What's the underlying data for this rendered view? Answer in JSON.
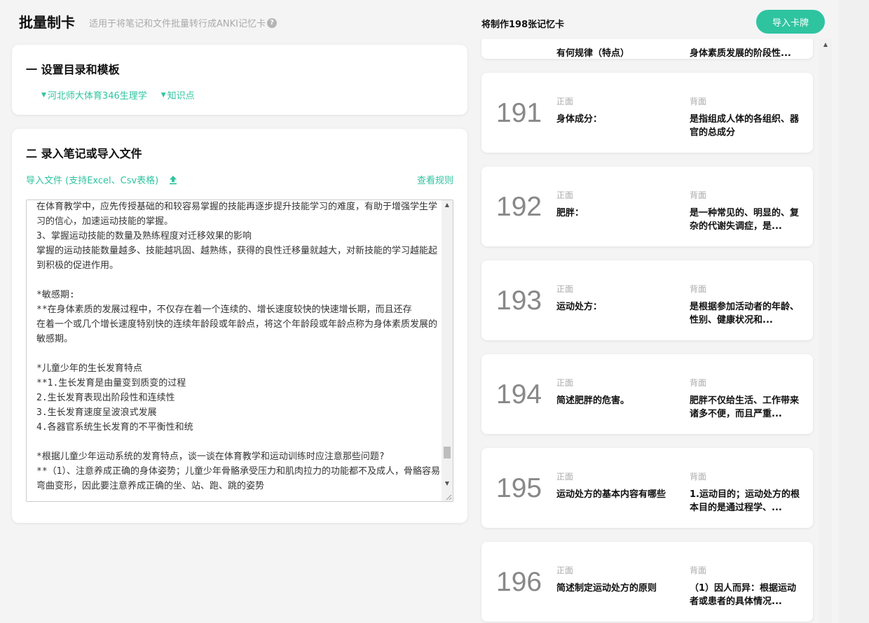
{
  "header": {
    "title": "批量制卡",
    "subtitle": "适用于将笔记和文件批量转行成ANKI记忆卡",
    "help_icon": "?",
    "card_count_text": "将制作198张记忆卡",
    "import_button": "导入卡牌"
  },
  "section1": {
    "heading": "一 设置目录和模板",
    "deck": "河北师大体育346生理学",
    "template": "知识点",
    "caret": "▼"
  },
  "section2": {
    "heading": "二 录入笔记或导入文件",
    "import_file": "导入文件 (支持Excel、Csv表格)",
    "view_rules": "查看规则",
    "editor_text": "在体育教学中，应先传授基础的和较容易掌握的技能再逐步提升技能学习的难度，有助于增强学生学习的信心，加速运动技能的掌握。\n3、掌握运动技能的数量及熟练程度对迁移效果的影响\n掌握的运动技能数量越多、技能越巩固、越熟练，获得的良性迁移量就越大，对新技能的学习越能起到积极的促进作用。\n\n*敏感期:\n**在身体素质的发展过程中，不仅存在着一个连续的、增长速度较快的快速增长期，而且还存\n在着一个或几个增长速度特别快的连续年龄段或年龄点，将这个年龄段或年龄点称为身体素质发展的敏感期。\n\n*儿童少年的生长发育特点\n**1.生长发育是由量变到质变的过程\n2.生长发育表现出阶段性和连续性\n3.生长发育速度呈波浪式发展\n4.各器官系统生长发育的不平衡性和统\n\n*根据儿童少年运动系统的发育特点，谈一谈在体育教学和运动训练时应注意那些问题?\n**（1）、注意养成正确的身体姿势；儿童少年骨骼承受压力和肌肉拉力的功能都不及成人，骨骼容易弯曲变形，因此要注意养成正确的坐、站、跑、跳的姿势"
  },
  "cards_partial": {
    "front": "有何规律（特点）",
    "back": "身体素质发展的阶段性..."
  },
  "labels": {
    "front": "正面",
    "back": "背面"
  },
  "cards": [
    {
      "num": "191",
      "front": "身体成分：",
      "back": "是指组成人体的各组织、器官的总成分"
    },
    {
      "num": "192",
      "front": "肥胖：",
      "back": "是一种常见的、明显的、复杂的代谢失调症，是..."
    },
    {
      "num": "193",
      "front": "运动处方：",
      "back": "是根据参加活动者的年龄、性别、健康状况和..."
    },
    {
      "num": "194",
      "front": "简述肥胖的危害。",
      "back": "肥胖不仅给生活、工作带来诸多不便，而且严重..."
    },
    {
      "num": "195",
      "front": "运动处方的基本内容有哪些",
      "back": "1.运动目的；运动处方的根本目的是通过程学、..."
    },
    {
      "num": "196",
      "front": "简述制定运动处方的原则",
      "back": "（1）因人而异：根据运动者或患者的具体情况..."
    }
  ]
}
